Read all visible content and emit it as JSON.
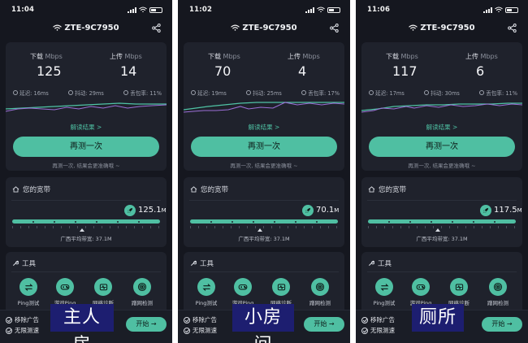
{
  "panels": [
    {
      "time": "11:04",
      "ssid": "ZTE-9C7950",
      "download_label": "下载",
      "upload_label": "上传",
      "unit": "Mbps",
      "download": "125",
      "upload": "14",
      "latency": "延迟: 16ms",
      "jitter": "抖动: 29ms",
      "loss": "丢包率: 11%",
      "read_link": "解读结果 >",
      "retest": "再测一次",
      "hint": "再测一次, 结果会更准确哦 ~",
      "bw_title": "您的宽带",
      "bw_value": "125.1",
      "bw_unit": "M",
      "bw_avg": "广西平均带宽: 37.1M",
      "tools_title": "工具",
      "tools": [
        "Ping测试",
        "游戏Ping",
        "网络诊断",
        "蹭网检测"
      ],
      "promo1": "移除广告",
      "promo2": "无限测速",
      "start": "开始 →",
      "room": "主人房",
      "bw_fraction": 0.76
    },
    {
      "time": "11:02",
      "ssid": "ZTE-9C7950",
      "download_label": "下载",
      "upload_label": "上传",
      "unit": "Mbps",
      "download": "70",
      "upload": "4",
      "latency": "延迟: 19ms",
      "jitter": "抖动: 25ms",
      "loss": "丢包率: 17%",
      "read_link": "解读结果 >",
      "retest": "再测一次",
      "hint": "再测一次, 结果会更准确哦 ~",
      "bw_title": "您的宽带",
      "bw_value": "70.1",
      "bw_unit": "M",
      "bw_avg": "广西平均带宽: 37.1M",
      "tools_title": "工具",
      "tools": [
        "Ping测试",
        "游戏Ping",
        "网络诊断",
        "蹭网检测"
      ],
      "promo1": "移除广告",
      "promo2": "无限测速",
      "start": "开始 →",
      "room": "小房间",
      "bw_fraction": 0.76
    },
    {
      "time": "11:06",
      "ssid": "ZTE-9C7950",
      "download_label": "下载",
      "upload_label": "上传",
      "unit": "Mbps",
      "download": "117",
      "upload": "6",
      "latency": "延迟: 17ms",
      "jitter": "抖动: 30ms",
      "loss": "丢包率: 11%",
      "read_link": "解读结果 >",
      "retest": "再测一次",
      "hint": "再测一次, 结果会更准确哦 ~",
      "bw_title": "您的宽带",
      "bw_value": "117.5",
      "bw_unit": "M",
      "bw_avg": "广西平均带宽: 37.1M",
      "tools_title": "工具",
      "tools": [
        "Ping测试",
        "游戏Ping",
        "网络诊断",
        "蹭网检测"
      ],
      "promo1": "移除广告",
      "promo2": "无限测速",
      "start": "开始 →",
      "room": "厕所",
      "bw_fraction": 0.76
    }
  ],
  "colors": {
    "accent": "#4fbfa2",
    "background": "#15171f",
    "card": "#1f222c",
    "download_line": "#4fc3a5",
    "upload_line": "#9b6fd6",
    "room_label_bg": "#1d1e70"
  },
  "icons": [
    "signal-icon",
    "wifi-icon",
    "battery-icon",
    "share-icon",
    "latency-icon",
    "jitter-icon",
    "loss-icon",
    "home-icon",
    "rocket-icon",
    "wrench-icon",
    "ping-icon",
    "gamepad-icon",
    "diagnose-icon",
    "scan-icon",
    "check-icon",
    "arrow-right-icon"
  ]
}
